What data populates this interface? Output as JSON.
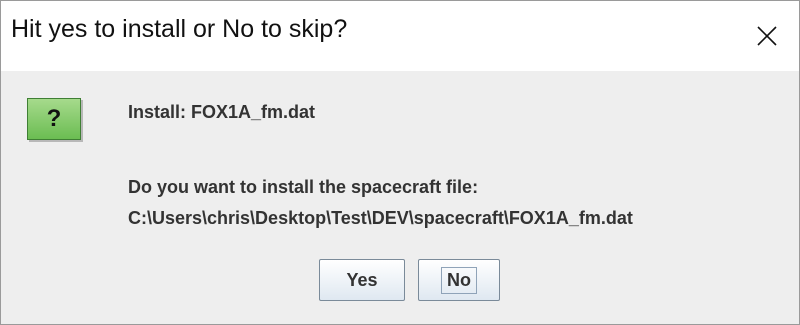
{
  "dialog": {
    "title": "Hit yes to install or No to skip?",
    "close_icon": "close-icon",
    "message_icon": "question-icon",
    "icon_glyph": "?",
    "install_line": "Install: FOX1A_fm.dat",
    "question_line": "Do you want to install the spacecraft file:",
    "path_line": "C:\\Users\\chris\\Desktop\\Test\\DEV\\spacecraft\\FOX1A_fm.dat"
  },
  "buttons": {
    "yes_label": "Yes",
    "no_label": "No"
  },
  "colors": {
    "icon_green": "#6bbd52",
    "dialog_background": "#eeeeee",
    "titlebar_background": "#ffffff"
  }
}
